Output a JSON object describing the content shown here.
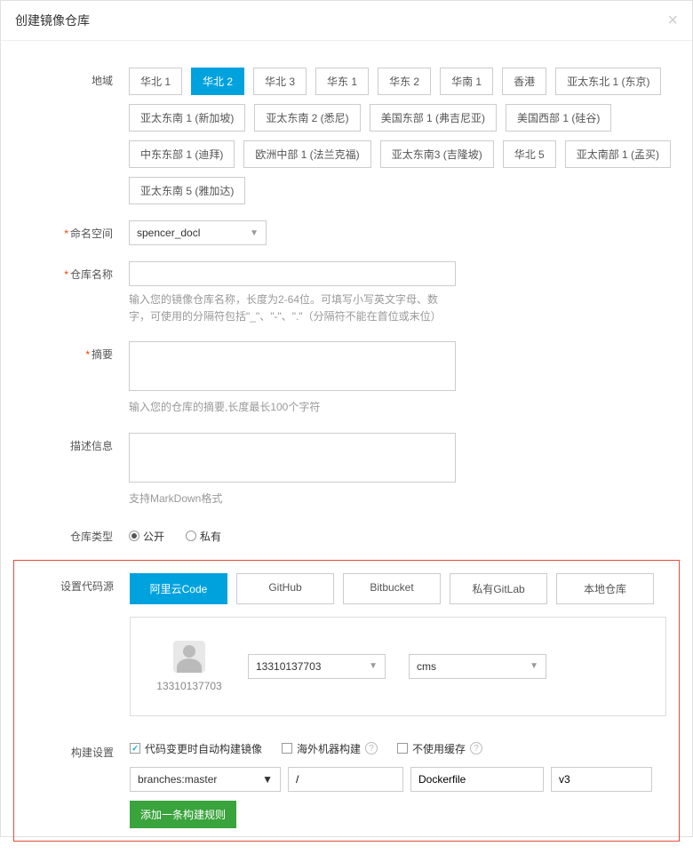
{
  "modal": {
    "title": "创建镜像仓库"
  },
  "region": {
    "label": "地域",
    "options": [
      "华北 1",
      "华北 2",
      "华北 3",
      "华东 1",
      "华东 2",
      "华南 1",
      "香港",
      "亚太东北 1 (东京)",
      "亚太东南 1 (新加坡)",
      "亚太东南 2 (悉尼)",
      "美国东部 1 (弗吉尼亚)",
      "美国西部 1 (硅谷)",
      "中东东部 1 (迪拜)",
      "欧洲中部 1 (法兰克福)",
      "亚太东南3 (吉隆坡)",
      "华北 5",
      "亚太南部 1 (孟买)",
      "亚太东南 5 (雅加达)"
    ],
    "active": "华北 2"
  },
  "namespace": {
    "label": "命名空间",
    "value": "spencer_docl"
  },
  "repoName": {
    "label": "仓库名称",
    "value": "",
    "help": "输入您的镜像仓库名称，长度为2-64位。可填写小写英文字母、数字，可使用的分隔符包括\"_\"、\"-\"、\".\"（分隔符不能在首位或末位）"
  },
  "summary": {
    "label": "摘要",
    "value": "",
    "help": "输入您的仓库的摘要,长度最长100个字符"
  },
  "description": {
    "label": "描述信息",
    "value": "",
    "help": "支持MarkDown格式"
  },
  "repoType": {
    "label": "仓库类型",
    "public": "公开",
    "private": "私有",
    "value": "public"
  },
  "codeSource": {
    "label": "设置代码源",
    "tabs": [
      "阿里云Code",
      "GitHub",
      "Bitbucket",
      "私有GitLab",
      "本地仓库"
    ],
    "active": "阿里云Code",
    "user": "13310137703",
    "project": "13310137703",
    "repo": "cms"
  },
  "buildSettings": {
    "label": "构建设置",
    "autoBuild": "代码变更时自动构建镜像",
    "overseas": "海外机器构建",
    "noCache": "不使用缓存",
    "branch": "branches:master",
    "path": "/",
    "dockerfile": "Dockerfile",
    "tag": "v3",
    "addRule": "添加一条构建规则"
  }
}
